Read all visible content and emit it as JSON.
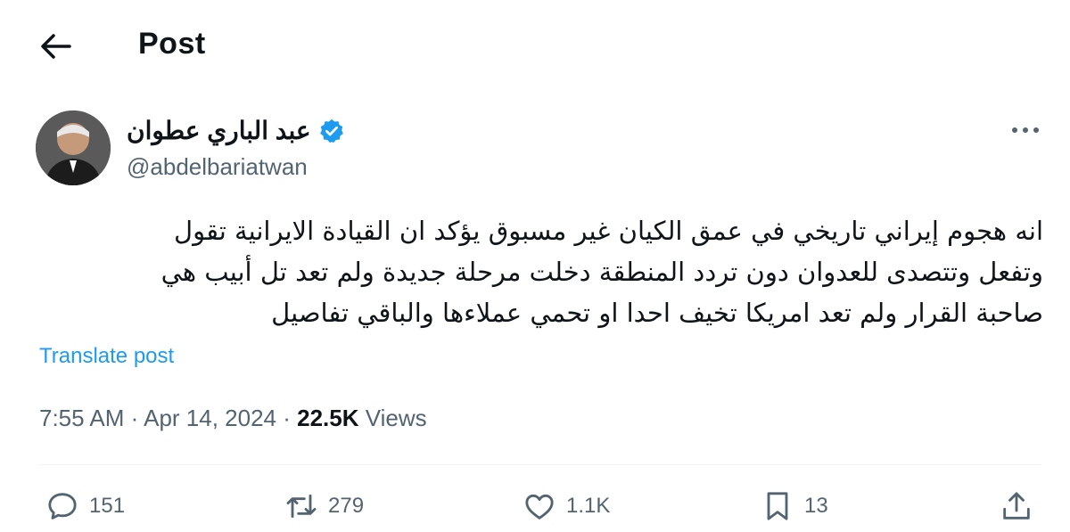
{
  "header": {
    "title": "Post"
  },
  "author": {
    "name": "عبد الباري عطوان",
    "handle": "@abdelbariatwan"
  },
  "tweet": {
    "lines": [
      "انه هجوم إيراني تاريخي في عمق الكيان غير مسبوق يؤكد ان القيادة الايرانية تقول",
      "وتفعل وتتصدى للعدوان دون تردد المنطقة دخلت مرحلة جديدة ولم تعد تل أبيب هي",
      "صاحبة القرار ولم تعد امريكا تخيف احدا او تحمي عملاءها والباقي تفاصيل"
    ],
    "translate_label": "Translate post"
  },
  "meta": {
    "time": "7:55 AM",
    "separator": "·",
    "date": "Apr 14, 2024",
    "views_count": "22.5K",
    "views_label": "Views"
  },
  "actions": {
    "replies": "151",
    "reposts": "279",
    "likes": "1.1K",
    "bookmarks": "13"
  },
  "colors": {
    "accent": "#1d9bf0",
    "secondary_text": "#536471",
    "primary_text": "#0f1419"
  },
  "icons": [
    "arrow-left-icon",
    "verified-badge-icon",
    "more-icon",
    "reply-icon",
    "repost-icon",
    "like-icon",
    "bookmark-icon",
    "share-icon"
  ]
}
